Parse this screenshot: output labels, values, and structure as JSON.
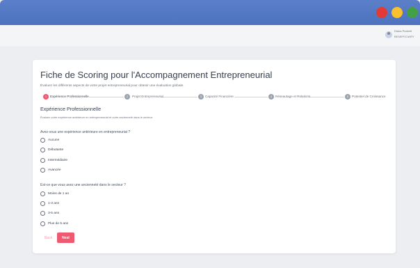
{
  "colors": {
    "titlebar": "#4d72bf",
    "accent": "#ef5a6f",
    "dot_red": "#e53935",
    "dot_yellow": "#fbc02d",
    "dot_green": "#43a047"
  },
  "appbar": {
    "theme_icon": "sun-icon",
    "translate_icon": "translate-icon",
    "bell_icon": "bell-icon",
    "user_name": "Diana Puckett",
    "user_role": "BENEFICIARY"
  },
  "form": {
    "title": "Fiche de Scoring pour l'Accompagnement Entrepreneurial",
    "subtitle": "Évaluez les différents aspects de votre projet entrepreneurial pour obtenir une évaluation globale.",
    "steps": [
      {
        "number": "1",
        "label": "Expérience Professionnelle",
        "active": true
      },
      {
        "number": "2",
        "label": "Projet Entrepreneurial",
        "active": false
      },
      {
        "number": "3",
        "label": "Capacité Financière",
        "active": false
      },
      {
        "number": "4",
        "label": "Réseautage et Relations",
        "active": false
      },
      {
        "number": "5",
        "label": "Potentiel de Croissance",
        "active": false
      }
    ],
    "section_title": "Expérience Professionnelle",
    "section_desc": "Évaluez votre expérience antérieure en entrepreneuriat et votre ancienneté dans le secteur.",
    "questions": [
      {
        "label": "Avez-vous une expérience antérieure en entrepreneuriat ?",
        "options": [
          "Aucune",
          "Débutante",
          "Intermédiaire",
          "Avancée"
        ]
      },
      {
        "label": "Est-ce que vous avez une ancienneté dans le secteur ?",
        "options": [
          "Moins de 1 an",
          "1-3 ans",
          "3-5 ans",
          "Plus de 5 ans"
        ]
      }
    ],
    "back_label": "Back",
    "next_label": "Next"
  }
}
